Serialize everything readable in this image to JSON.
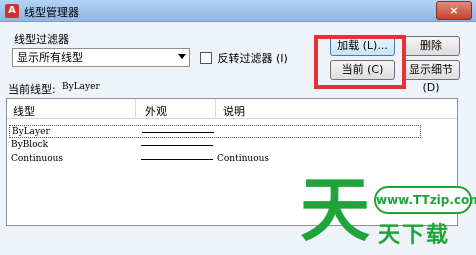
{
  "window": {
    "icon": "A",
    "title": "线型管理器",
    "close_label": "×"
  },
  "filter": {
    "label": "线型过滤器",
    "selected": "显示所有线型",
    "invert_label": "反转过滤器 (I)"
  },
  "buttons": {
    "load": "加载 (L)...",
    "delete": "删除",
    "current": "当前 (C)",
    "details": "显示细节 (D)"
  },
  "current_linetype": {
    "label": "当前线型:",
    "value": "ByLayer"
  },
  "table": {
    "columns": [
      "线型",
      "外观",
      "说明"
    ],
    "rows": [
      {
        "name": "ByLayer",
        "description": ""
      },
      {
        "name": "ByBlock",
        "description": ""
      },
      {
        "name": "Continuous",
        "description": "Continuous"
      }
    ]
  },
  "watermark": {
    "logo_char": "天",
    "url": "www.TTzip.com",
    "sub": "天下载"
  },
  "colors": {
    "highlight": "#e53234",
    "watermark": "#1fa33a"
  }
}
